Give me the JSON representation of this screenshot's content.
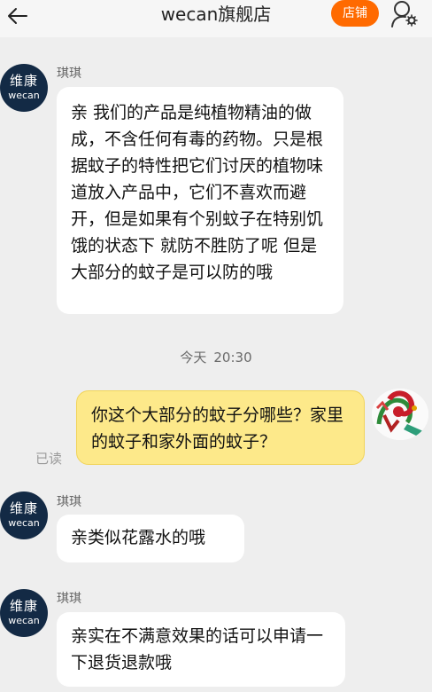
{
  "header": {
    "title": "wecan旗舰店",
    "shop_button": "店铺"
  },
  "store_avatar": {
    "cn": "维康",
    "en": "wecan"
  },
  "timestamp": {
    "day": "今天",
    "time": "20:30"
  },
  "read_status": "已读",
  "messages": [
    {
      "sender": "琪琪",
      "text": "亲 我们的产品是纯植物精油的做成，不含任何有毒的药物。只是根据蚊子的特性把它们讨厌的植物味道放入产品中，它们不喜欢而避开，但是如果有个别蚊子在特别饥饿的状态下 就防不胜防了呢  但是大部分的蚊子是可以防的哦"
    },
    {
      "sender": "",
      "text": "你这个大部分的蚊子分哪些？家里的蚊子和家外面的蚊子？"
    },
    {
      "sender": "琪琪",
      "text": "亲类似花露水的哦"
    },
    {
      "sender": "琪琪",
      "text": "亲实在不满意效果的话可以申请一下退货退款哦"
    }
  ],
  "colors": {
    "shop_button": "#ff6a00",
    "my_bubble": "#fde98a",
    "avatar_bg": "#132a45",
    "background": "#eeeeee"
  }
}
